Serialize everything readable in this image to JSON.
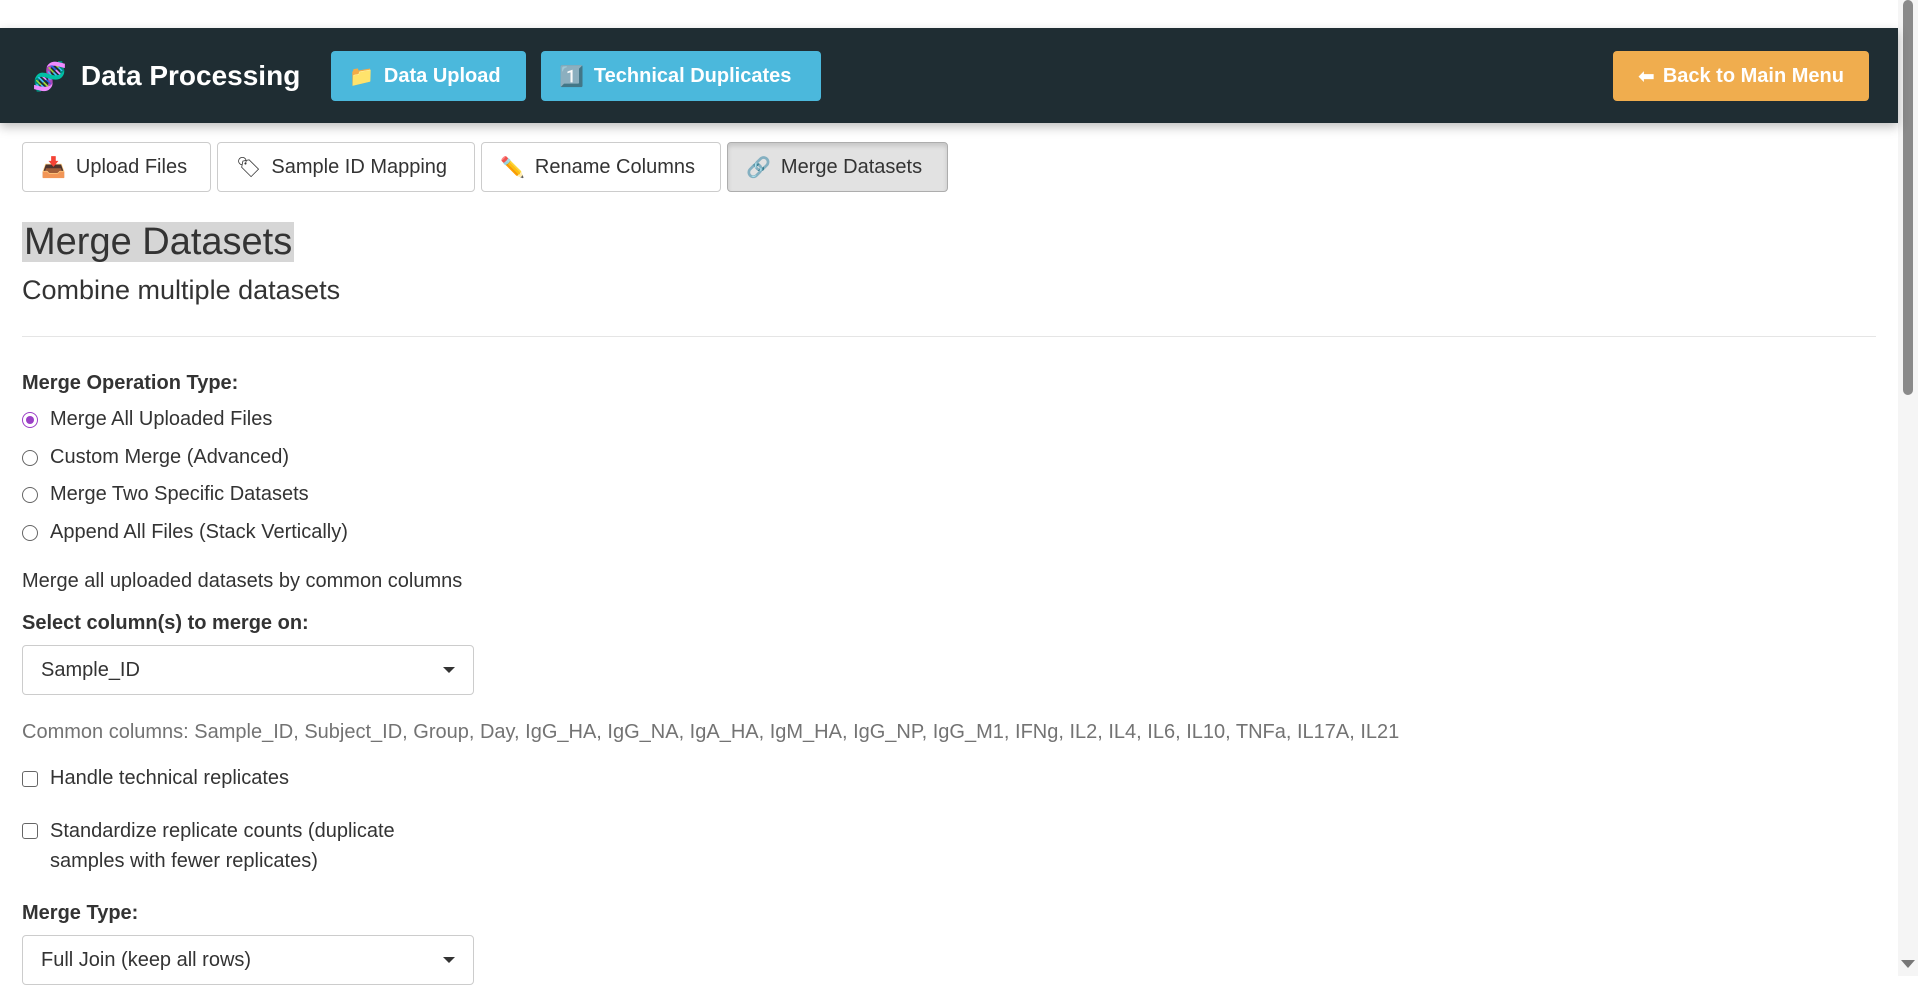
{
  "navbar": {
    "brand_icon": "🧬",
    "brand_title": "Data Processing",
    "data_upload_icon": "📁",
    "data_upload_label": "Data Upload",
    "tech_dup_icon": "1️⃣",
    "tech_dup_label": "Technical Duplicates",
    "back_icon": "⬅",
    "back_label": "Back to Main Menu"
  },
  "tabs": [
    {
      "icon": "📥",
      "label": "Upload Files"
    },
    {
      "icon": "🏷",
      "label": "Sample ID Mapping"
    },
    {
      "icon": "✏️",
      "label": "Rename Columns"
    },
    {
      "icon": "🔗",
      "label": "Merge Datasets"
    }
  ],
  "section": {
    "title": "Merge Datasets",
    "subtitle": "Combine multiple datasets"
  },
  "merge_operation": {
    "label": "Merge Operation Type:",
    "options": [
      "Merge All Uploaded Files",
      "Custom Merge (Advanced)",
      "Merge Two Specific Datasets",
      "Append All Files (Stack Vertically)"
    ],
    "selected_index": 0
  },
  "description": "Merge all uploaded datasets by common columns",
  "merge_on": {
    "label": "Select column(s) to merge on:",
    "value": "Sample_ID"
  },
  "common_columns": "Common columns: Sample_ID, Subject_ID, Group, Day, IgG_HA, IgG_NA, IgA_HA, IgM_HA, IgG_NP, IgG_M1, IFNg, IL2, IL4, IL6, IL10, TNFa, IL17A, IL21",
  "checkboxes": {
    "handle_replicates": "Handle technical replicates",
    "standardize_line1": "Standardize replicate counts (duplicate",
    "standardize_line2": "samples with fewer replicates)"
  },
  "merge_type": {
    "label": "Merge Type:",
    "value": "Full Join (keep all rows)"
  },
  "colors": {
    "navbar_bg": "#1f2d33",
    "info_button": "#4bb8dc",
    "warning_button": "#f0ad4e",
    "radio_accent": "#9b3fc6"
  }
}
